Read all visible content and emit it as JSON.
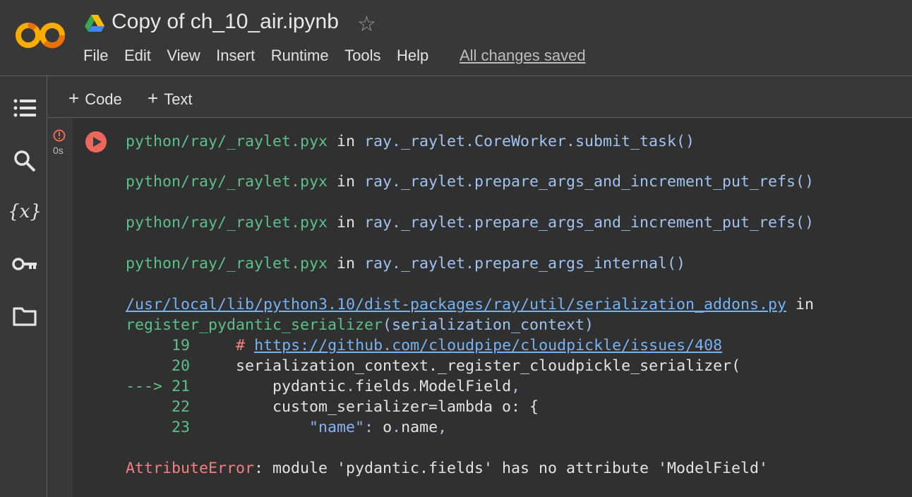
{
  "header": {
    "title": "Copy of ch_10_air.ipynb",
    "menu": [
      "File",
      "Edit",
      "View",
      "Insert",
      "Runtime",
      "Tools",
      "Help"
    ],
    "save_status": "All changes saved"
  },
  "sidebar": {
    "icons": [
      "table-of-contents-icon",
      "search-icon",
      "variables-icon",
      "secrets-key-icon",
      "files-folder-icon"
    ],
    "variables_glyph": "{x}"
  },
  "toolbar": {
    "add_code_label": "Code",
    "add_text_label": "Text",
    "plus": "+"
  },
  "cell": {
    "exec_time": "0s"
  },
  "output": {
    "frames": [
      {
        "file": "python/ray/_raylet.pyx",
        "in": " in ",
        "func": "ray._raylet.CoreWorker.submit_task()"
      },
      {
        "file": "python/ray/_raylet.pyx",
        "in": " in ",
        "func": "ray._raylet.prepare_args_and_increment_put_refs()"
      },
      {
        "file": "python/ray/_raylet.pyx",
        "in": " in ",
        "func": "ray._raylet.prepare_args_and_increment_put_refs()"
      },
      {
        "file": "python/ray/_raylet.pyx",
        "in": " in ",
        "func": "ray._raylet.prepare_args_internal()"
      }
    ],
    "final_frame": {
      "path": "/usr/local/lib/python3.10/dist-packages/ray/util/serialization_addons.py",
      "in": " in",
      "func_name": "register_pydantic_serializer",
      "func_args": "(serialization_context)"
    },
    "code_lines": [
      {
        "prefix": "     ",
        "num": "19",
        "pad": "     ",
        "comment": "# ",
        "link": "https://github.com/cloudpipe/cloudpickle/issues/408"
      },
      {
        "prefix": "     ",
        "num": "20",
        "pad": "     ",
        "text": "serialization_context._register_cloudpickle_serializer("
      },
      {
        "prefix": "---> ",
        "num": "21",
        "pad": "         ",
        "p1": "pydantic",
        "dot1": ".",
        "p2": "fields",
        "dot2": ".",
        "p3": "ModelField",
        "comma": ","
      },
      {
        "prefix": "     ",
        "num": "22",
        "pad": "         ",
        "text": "custom_serializer=lambda o: {"
      },
      {
        "prefix": "     ",
        "num": "23",
        "pad": "             ",
        "key": "\"name\"",
        "colon": ": ",
        "o": "o",
        "dot": ".",
        "name": "name",
        "comma": ","
      }
    ],
    "error": {
      "type": "AttributeError",
      "message": ": module 'pydantic.fields' has no attribute 'ModelField'"
    }
  }
}
